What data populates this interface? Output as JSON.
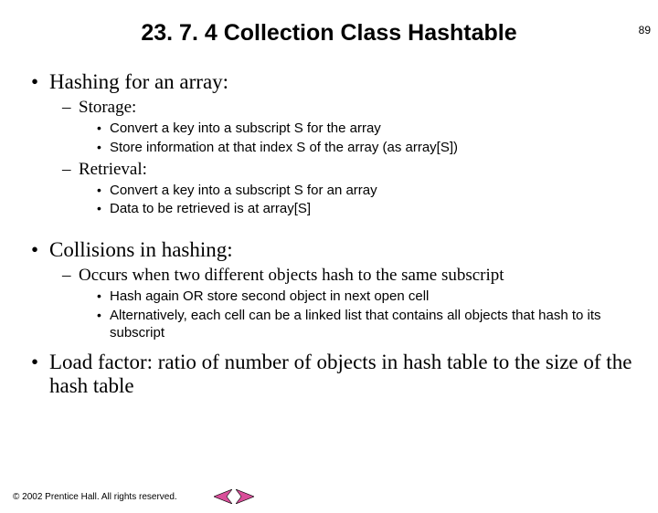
{
  "page_number": "89",
  "title": "23. 7. 4 Collection Class Hashtable",
  "bullets": {
    "b1": "Hashing for an array:",
    "b1_1": "Storage:",
    "b1_1_1": "Convert a key into a subscript S for the array",
    "b1_1_2": "Store information at that index S of the array (as array[S])",
    "b1_2": "Retrieval:",
    "b1_2_1": "Convert a key into a subscript S for an array",
    "b1_2_2": "Data to be retrieved is at array[S]",
    "b2": "Collisions in hashing:",
    "b2_1": "Occurs when two different objects hash to the same subscript",
    "b2_1_1": "Hash again OR store second object in next open cell",
    "b2_1_2": "Alternatively, each cell can be a linked list that contains all objects that hash to its subscript",
    "b3": "Load factor: ratio of number of objects in hash table to the size of the hash table"
  },
  "footer": "© 2002 Prentice Hall. All rights reserved.",
  "icons": {
    "prev": "prev-arrow-icon",
    "next": "next-arrow-icon"
  },
  "colors": {
    "arrow_fill": "#d94f9a",
    "arrow_stroke": "#000000"
  }
}
